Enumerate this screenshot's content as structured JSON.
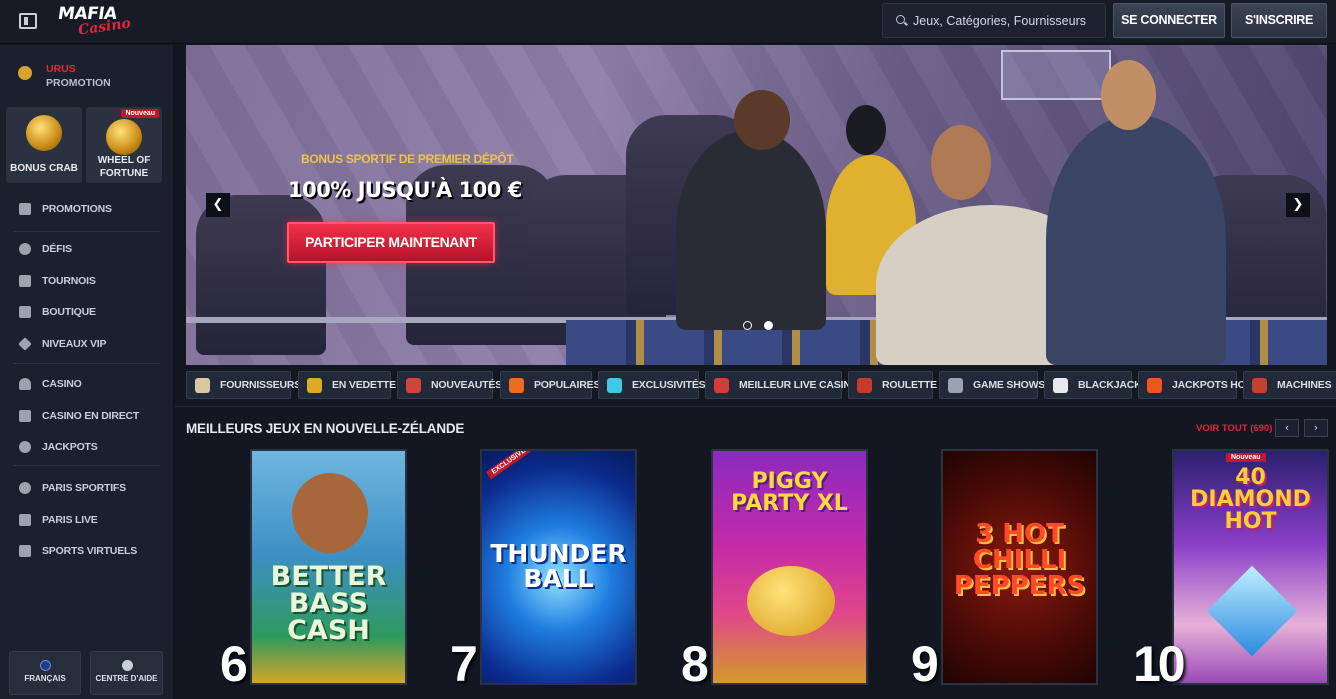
{
  "header": {
    "logo_main": "MAFIA",
    "logo_sub": "Casino",
    "search_placeholder": "Jeux, Catégories, Fournisseurs",
    "login_label": "SE CONNECTER",
    "signup_label": "S'INSCRIRE"
  },
  "sidebar": {
    "promo": {
      "line1": "URUS",
      "line2": "PROMOTION"
    },
    "tiles": [
      {
        "label": "BONUS CRAB"
      },
      {
        "label": "WHEEL OF FORTUNE",
        "badge": "Nouveau"
      }
    ],
    "items": [
      {
        "label": "PROMOTIONS",
        "icon": "gift-icon"
      },
      {
        "label": "DÉFIS",
        "icon": "target-icon"
      },
      {
        "label": "TOURNOIS",
        "icon": "trophy-icon"
      },
      {
        "label": "BOUTIQUE",
        "icon": "shop-icon"
      },
      {
        "label": "NIVEAUX VIP",
        "icon": "diamond-icon"
      },
      {
        "label": "CASINO",
        "icon": "spade-icon"
      },
      {
        "label": "CASINO EN DIRECT",
        "icon": "live-icon"
      },
      {
        "label": "JACKPOTS",
        "icon": "clover-icon"
      },
      {
        "label": "PARIS SPORTIFS",
        "icon": "football-icon"
      },
      {
        "label": "PARIS LIVE",
        "icon": "live-bet-icon"
      },
      {
        "label": "SPORTS VIRTUELS",
        "icon": "virtual-sports-icon"
      }
    ],
    "footer": {
      "language": "FRANÇAIS",
      "help": "CENTRE D'AIDE"
    }
  },
  "hero": {
    "subtitle": "BONUS SPORTIF DE PREMIER DÉPÔT",
    "title": "100% JUSQU'À 100 €",
    "cta": "PARTICIPER MAINTENANT",
    "slides_total": 2,
    "slide_active": 2
  },
  "categories": [
    {
      "label": "FOURNISSEURS",
      "color": "#d8c7a0"
    },
    {
      "label": "EN VEDETTE",
      "color": "#e0a92a"
    },
    {
      "label": "NOUVEAUTÉS",
      "color": "#d3433a"
    },
    {
      "label": "POPULAIRES",
      "color": "#f06a1e"
    },
    {
      "label": "EXCLUSIVITÉS",
      "color": "#3fc9e6"
    },
    {
      "label": "MEILLEUR LIVE CASINO",
      "color": "#d63a3a"
    },
    {
      "label": "ROULETTE",
      "color": "#c83a2a"
    },
    {
      "label": "GAME SHOWS",
      "color": "#9aa3b3"
    },
    {
      "label": "BLACKJACK",
      "color": "#e8e8ee"
    },
    {
      "label": "JACKPOTS HOT",
      "color": "#f0551e"
    },
    {
      "label": "MACHINES",
      "color": "#c4412e"
    }
  ],
  "section": {
    "title": "MEILLEURS JEUX EN NOUVELLE-ZÉLANDE",
    "see_all": "VOIR TOUT (690)"
  },
  "games": [
    {
      "rank": "6",
      "name": "BETTER BASS CASH"
    },
    {
      "rank": "7",
      "name": "THUNDER BALL",
      "tag": "EXCLUSIVE"
    },
    {
      "rank": "8",
      "name": "PIGGY PARTY XL"
    },
    {
      "rank": "9",
      "name": "3 HOT CHILLI PEPPERS"
    },
    {
      "rank": "10",
      "name": "40 DIAMOND HOT",
      "tag": "Nouveau"
    }
  ]
}
